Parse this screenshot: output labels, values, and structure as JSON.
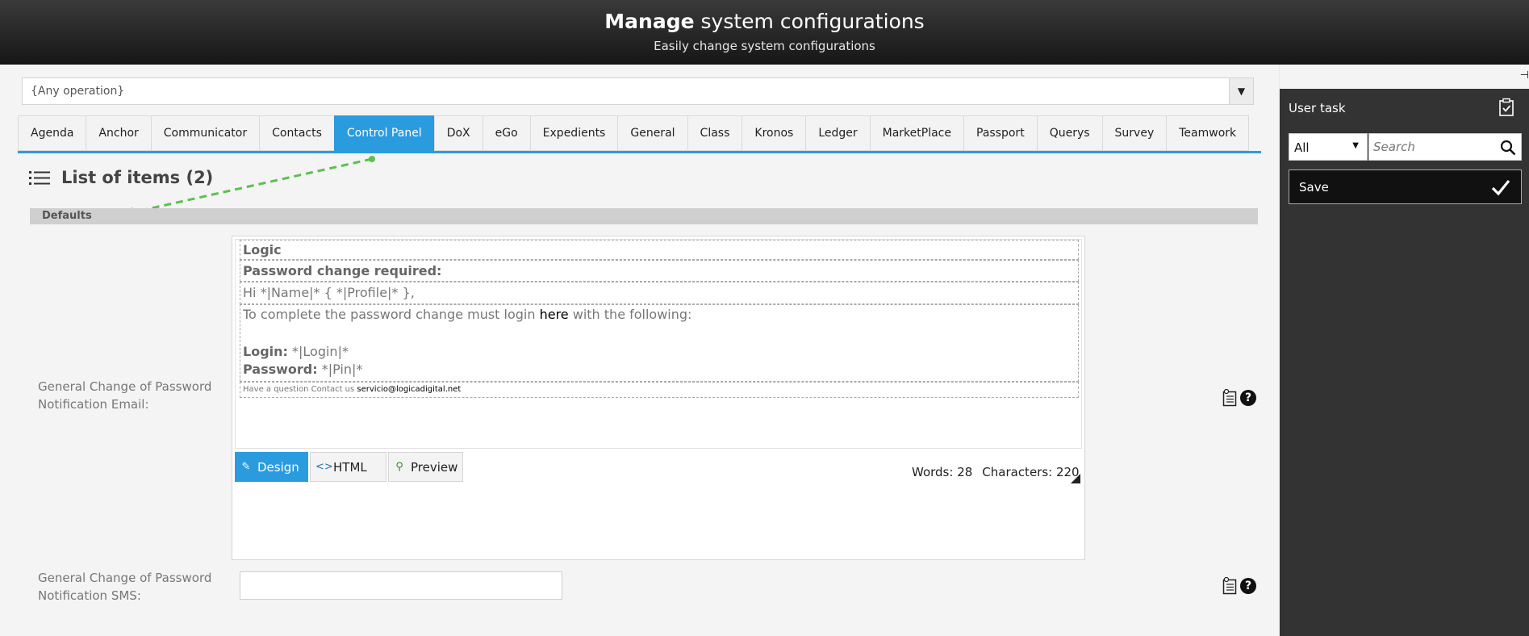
{
  "header": {
    "title_bold": "Manage",
    "title_rest": " system configurations",
    "subtitle": "Easily change system configurations"
  },
  "operation_select": {
    "value": "{Any operation}"
  },
  "tabs": [
    {
      "label": "Agenda"
    },
    {
      "label": "Anchor"
    },
    {
      "label": "Communicator"
    },
    {
      "label": "Contacts"
    },
    {
      "label": "Control Panel",
      "active": true
    },
    {
      "label": "DoX"
    },
    {
      "label": "eGo"
    },
    {
      "label": "Expedients"
    },
    {
      "label": "General"
    },
    {
      "label": "Class"
    },
    {
      "label": "Kronos"
    },
    {
      "label": "Ledger"
    },
    {
      "label": "MarketPlace"
    },
    {
      "label": "Passport"
    },
    {
      "label": "Querys"
    },
    {
      "label": "Survey"
    },
    {
      "label": "Teamwork"
    }
  ],
  "list": {
    "title": "List of items (2)",
    "section": "Defaults"
  },
  "fields": {
    "email": {
      "label_line1": "General Change of Password",
      "label_line2": "Notification Email:",
      "template": {
        "logic": "Logic",
        "heading": "Password change required:",
        "greeting": "Hi *|Name|* { *|Profile|* },",
        "body_before": "To complete the password change must login ",
        "body_link": "here",
        "body_after": " with the following:",
        "login_label": "Login:",
        "login_value": " *|Login|*",
        "password_label": "Password:",
        "password_value": " *|Pin|*",
        "footer_text": "Have a question Contact us ",
        "footer_email": "servicio@logicadigital.net"
      },
      "editor_modes": {
        "design": "Design",
        "html": "HTML",
        "preview": "Preview"
      },
      "words": "Words: 28",
      "characters": "Characters: 220"
    },
    "sms": {
      "label_line1": "General Change of Password",
      "label_line2": "Notification SMS:",
      "value": ""
    }
  },
  "right_panel": {
    "title": "User task",
    "filter_value": "All",
    "search_placeholder": "Search",
    "save_label": "Save"
  },
  "colors": {
    "accent": "#2b9be0",
    "arrow": "#5cc04e"
  },
  "icons": [
    "list-icon",
    "clipboard-icon",
    "help-icon",
    "search-icon",
    "check-icon",
    "pin-icon",
    "pencil-icon",
    "code-icon",
    "magnifier-icon"
  ]
}
